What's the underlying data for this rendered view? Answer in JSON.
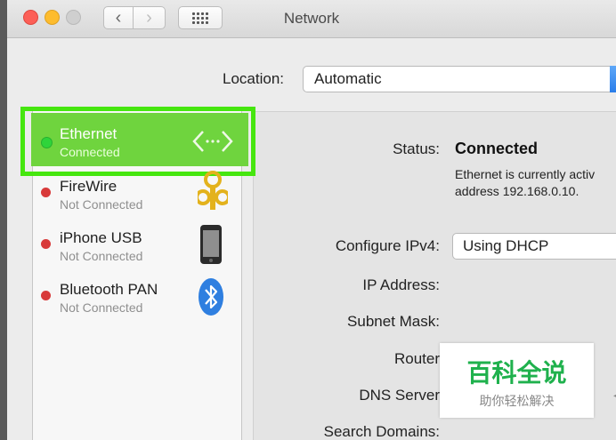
{
  "window": {
    "title": "Network"
  },
  "location": {
    "label": "Location:",
    "value": "Automatic"
  },
  "services": [
    {
      "name": "Ethernet",
      "status": "Connected",
      "dot": "#2fd43a",
      "icon": "ethernet-icon"
    },
    {
      "name": "FireWire",
      "status": "Not Connected",
      "dot": "#d83a3a",
      "icon": "firewire-icon"
    },
    {
      "name": "iPhone USB",
      "status": "Not Connected",
      "dot": "#d83a3a",
      "icon": "iphone-icon"
    },
    {
      "name": "Bluetooth PAN",
      "status": "Not Connected",
      "dot": "#d83a3a",
      "icon": "bluetooth-icon"
    }
  ],
  "details": {
    "status_label": "Status:",
    "status_value": "Connected",
    "status_desc_1": "Ethernet is currently activ",
    "status_desc_2": "address 192.168.0.10.",
    "configure_label": "Configure IPv4:",
    "configure_value": "Using DHCP",
    "ip_label": "IP Address:",
    "subnet_label": "Subnet Mask:",
    "router_label": "Router",
    "dns_label": "DNS Server",
    "search_label": "Search Domains:"
  },
  "watermark": {
    "title": "百科全说",
    "subtitle": "助你轻松解决"
  },
  "colors": {
    "selection_border": "#46e60f",
    "selection_fill": "#6fd43e",
    "watermark_green": "#1fb14d"
  }
}
